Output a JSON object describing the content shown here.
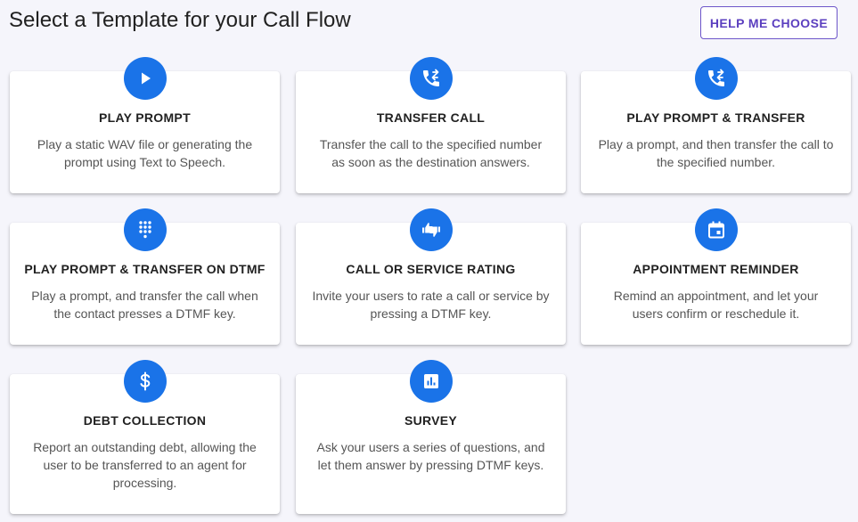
{
  "header": {
    "title": "Select a Template for your Call Flow",
    "help_button_label": "HELP ME CHOOSE"
  },
  "colors": {
    "accent": "#1a73e8",
    "button_text": "#5b3fbf"
  },
  "templates": [
    {
      "icon": "play-icon",
      "title": "PLAY PROMPT",
      "description": "Play a static WAV file or generating the prompt using Text to Speech."
    },
    {
      "icon": "phone-forward-icon",
      "title": "TRANSFER CALL",
      "description": "Transfer the call to the specified number as soon as the destination answers."
    },
    {
      "icon": "phone-forward-icon",
      "title": "PLAY PROMPT & TRANSFER",
      "description": "Play a prompt, and then transfer the call to the specified number."
    },
    {
      "icon": "dialpad-icon",
      "title": "PLAY PROMPT & TRANSFER ON DTMF",
      "description": "Play a prompt, and transfer the call when the contact presses a DTMF key."
    },
    {
      "icon": "thumbs-up-down-icon",
      "title": "CALL OR SERVICE RATING",
      "description": "Invite your users to rate a call or service by pressing a DTMF key."
    },
    {
      "icon": "calendar-event-icon",
      "title": "APPOINTMENT REMINDER",
      "description": "Remind an appointment, and let your users confirm or reschedule it."
    },
    {
      "icon": "dollar-icon",
      "title": "DEBT COLLECTION",
      "description": "Report an outstanding debt, allowing the user to be transferred to an agent for processing."
    },
    {
      "icon": "bar-chart-icon",
      "title": "SURVEY",
      "description": "Ask your users a series of questions, and let them answer by pressing DTMF keys."
    }
  ]
}
